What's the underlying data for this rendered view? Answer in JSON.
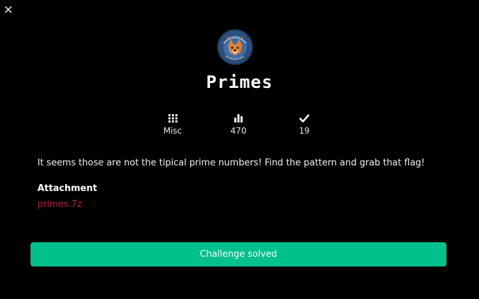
{
  "modal": {
    "close_icon": "close-icon",
    "title": "Primes",
    "stats": {
      "category": "Misc",
      "points": "470",
      "solves": "19"
    },
    "description": "It seems those are not the tipical prime numbers! Find the pattern and grab that flag!",
    "attachment_heading": "Attachment",
    "attachment_file": "primes.7z",
    "status_button": "Challenge solved"
  },
  "colors": {
    "background": "#000000",
    "accent": "#00c18c",
    "link": "#b81c3c"
  },
  "icons": [
    "close-icon",
    "grid-icon",
    "bar-chart-icon",
    "check-icon"
  ]
}
